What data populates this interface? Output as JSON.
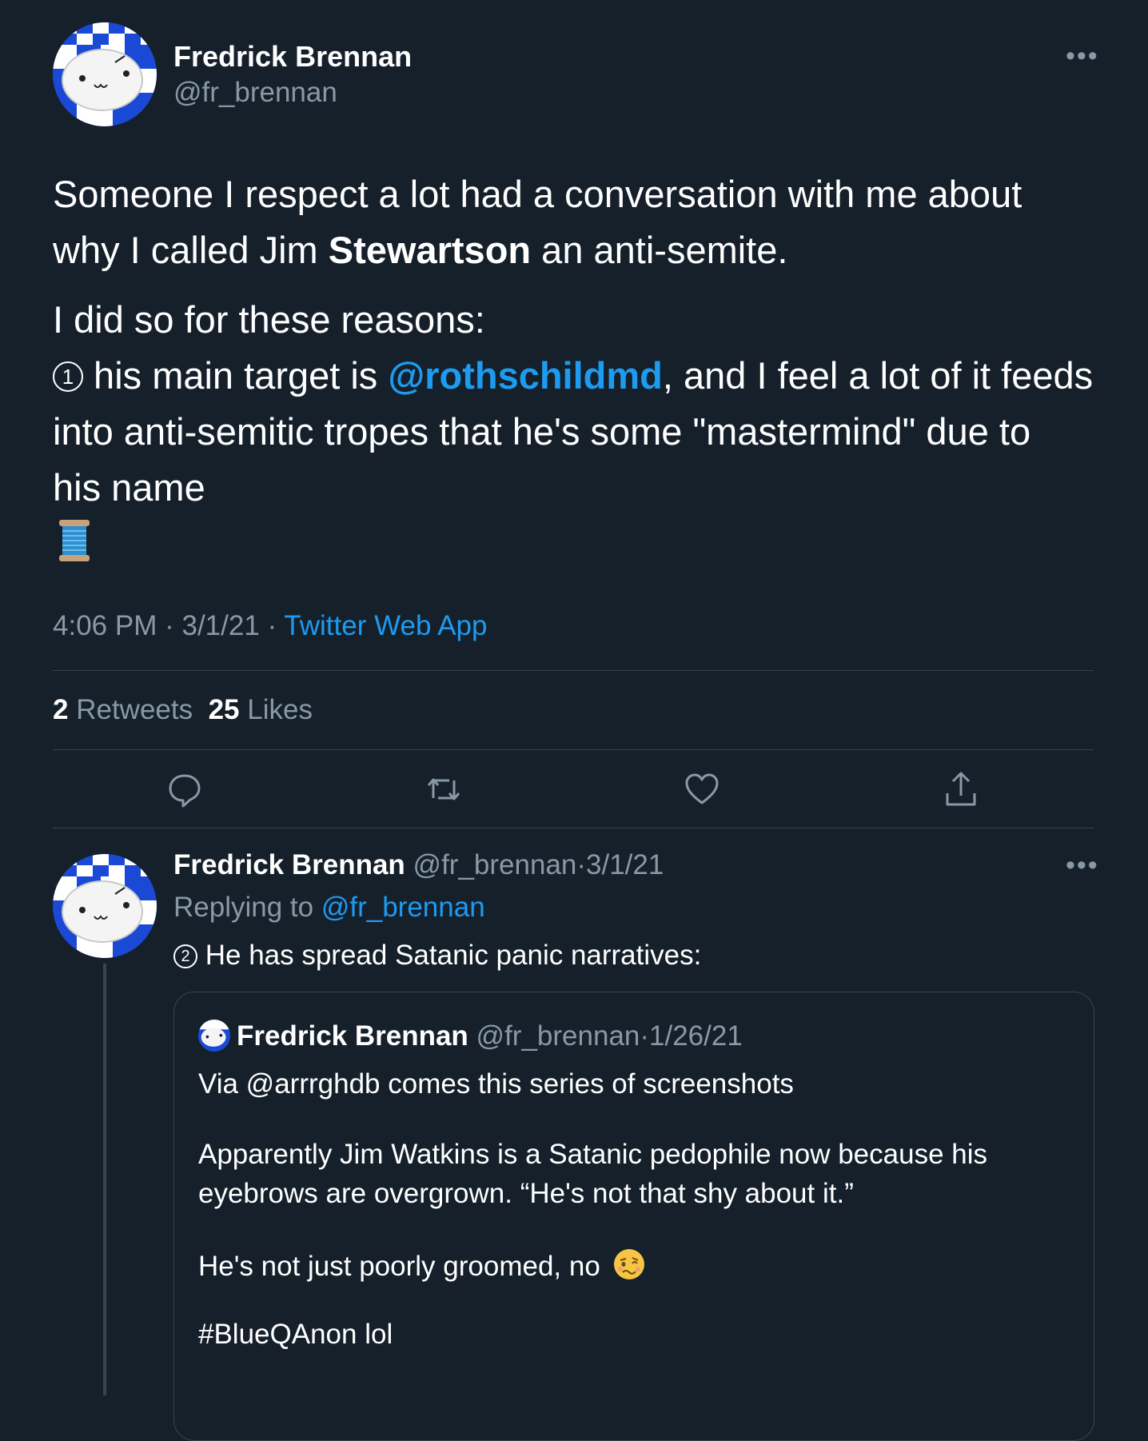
{
  "main_tweet": {
    "name": "Fredrick Brennan",
    "handle": "@fr_brennan",
    "p1_a": "Someone I respect a lot had a conversation with me about",
    "p1_b_pre": "why I called Jim ",
    "p1_b_bold": "Stewartson",
    "p1_b_post": " an anti-semite.",
    "p2_line1": "I did so for these reasons:",
    "p2_num": "1",
    "p2_l2_pre": " his main target is ",
    "p2_mention": "@rothschildmd",
    "p2_l2_post": ", and I feel a lot of it feeds",
    "p2_line3": "into anti-semitic tropes that he's some \"mastermind\" due to",
    "p2_line4": "his name",
    "emoji_icon": "spool-of-thread-icon",
    "time": "4:06 PM",
    "date": "3/1/21",
    "source": "Twitter Web App",
    "retweets_count": "2",
    "retweets_label": "Retweets",
    "likes_count": "25",
    "likes_label": "Likes"
  },
  "reply_tweet": {
    "name": "Fredrick Brennan",
    "handle": "@fr_brennan",
    "date": "3/1/21",
    "replying_label": "Replying to",
    "replying_handle": "@fr_brennan",
    "num": "2",
    "text": " He has spread Satanic panic narratives:"
  },
  "quoted_tweet": {
    "name": "Fredrick Brennan",
    "handle": "@fr_brennan",
    "date": "1/26/21",
    "line1": "Via @arrrghdb comes this series of screenshots",
    "line2": "Apparently Jim Watkins is a Satanic pedophile now because his",
    "line3": "eyebrows are overgrown. “He's not that shy about it.”",
    "line4": "He's not just poorly groomed, no",
    "line5": "#BlueQAnon lol",
    "emoji_icon": "woozy-face-icon"
  },
  "separator": "·",
  "colors": {
    "background": "#15202b",
    "accent": "#1d9bf0",
    "muted": "#8899a6",
    "divider": "#38444d"
  }
}
